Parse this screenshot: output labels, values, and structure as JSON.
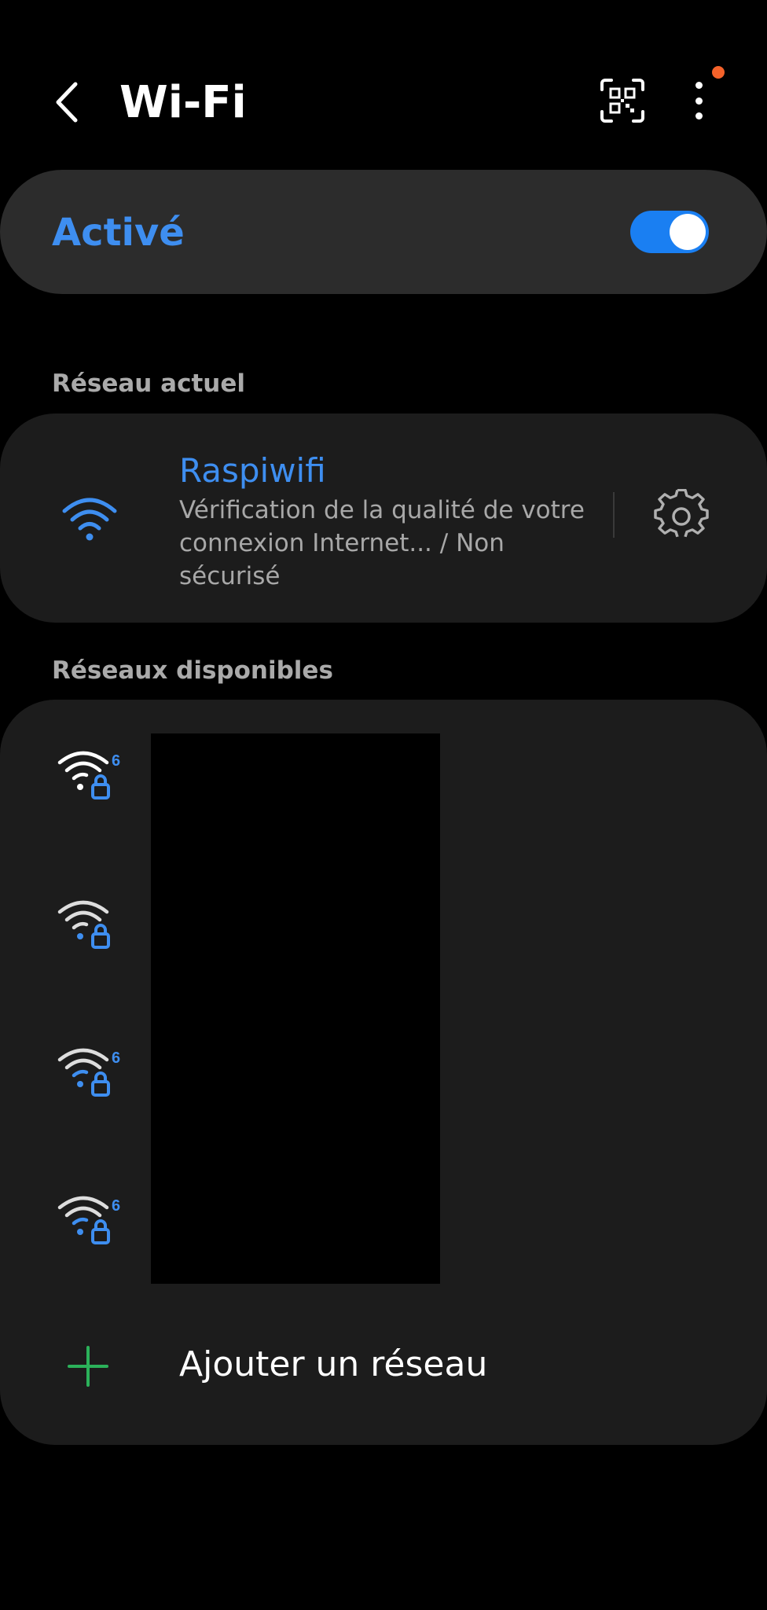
{
  "header": {
    "title": "Wi-Fi"
  },
  "toggle": {
    "label": "Activé",
    "on": true
  },
  "current_network": {
    "section_label": "Réseau actuel",
    "name": "Raspiwifi",
    "status": "Vérification de la qualité de votre connexion Internet... / Non sécurisé"
  },
  "available_networks": {
    "section_label": "Réseaux disponibles",
    "items": [
      {
        "icon": "wifi-6-locked-icon",
        "wifi6": true
      },
      {
        "icon": "wifi-locked-icon",
        "wifi6": false
      },
      {
        "icon": "wifi-6-locked-icon",
        "wifi6": true
      },
      {
        "icon": "wifi-6-locked-icon",
        "wifi6": true
      }
    ]
  },
  "add_network": {
    "label": "Ajouter un réseau"
  },
  "colors": {
    "accent": "#3e8ef0",
    "switch": "#1a7ff2",
    "notification": "#f4622a",
    "add": "#2bb15a",
    "card": "#1c1c1c"
  }
}
